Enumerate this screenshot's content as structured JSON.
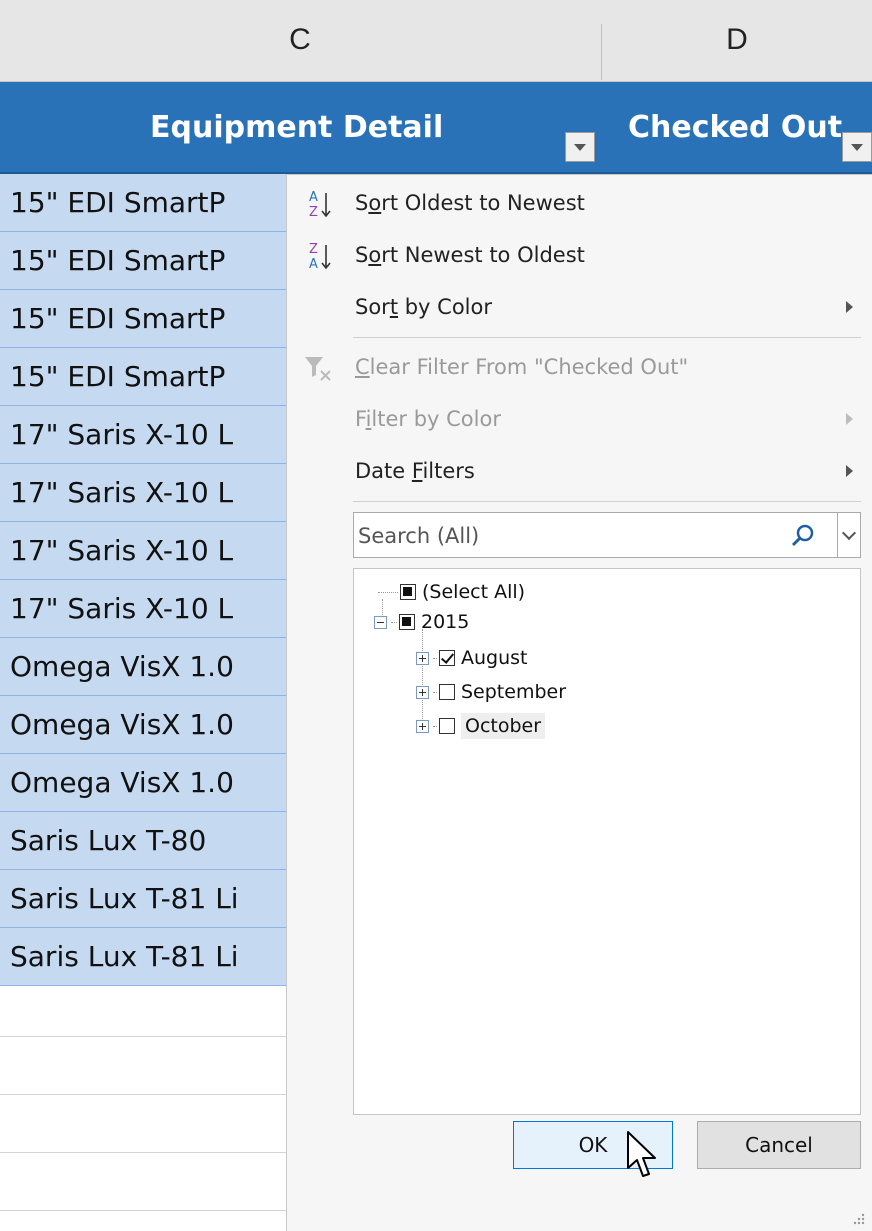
{
  "columns": {
    "c": "C",
    "d": "D"
  },
  "table_headers": {
    "equipment": "Equipment Detail",
    "checked_out": "Checked Out"
  },
  "rows": [
    "15\" EDI SmartP",
    "15\" EDI SmartP",
    "15\" EDI SmartP",
    "15\" EDI SmartP",
    "17\" Saris X-10 L",
    "17\" Saris X-10 L",
    "17\" Saris X-10 L",
    "17\" Saris X-10 L",
    "Omega VisX 1.0",
    "Omega VisX 1.0",
    "Omega VisX 1.0",
    "Saris Lux T-80",
    "Saris Lux T-81 Li",
    "Saris Lux T-81 Li"
  ],
  "menu": {
    "sort_oldest": {
      "pre": "S",
      "u": "o",
      "post": "rt Oldest to Newest"
    },
    "sort_newest": {
      "pre": "S",
      "u": "o",
      "post": "rt Newest to Oldest"
    },
    "sort_color": {
      "pre": "Sor",
      "u": "t",
      "post": " by Color"
    },
    "clear_filter": {
      "pre": "",
      "u": "C",
      "post": "lear Filter From \"Checked Out\""
    },
    "filter_color": {
      "pre": "F",
      "u": "i",
      "post": "lter by Color"
    },
    "date_filters": {
      "pre": "Date ",
      "u": "F",
      "post": "ilters"
    }
  },
  "search": {
    "placeholder": "Search (All)"
  },
  "tree": {
    "select_all": "(Select All)",
    "year": "2015",
    "months": [
      "August",
      "September",
      "October"
    ]
  },
  "buttons": {
    "ok": "OK",
    "cancel": "Cancel"
  },
  "colors": {
    "header_blue": "#2a72b8",
    "row_fill": "#c5d9f1",
    "row_border": "#8eb4e3"
  }
}
